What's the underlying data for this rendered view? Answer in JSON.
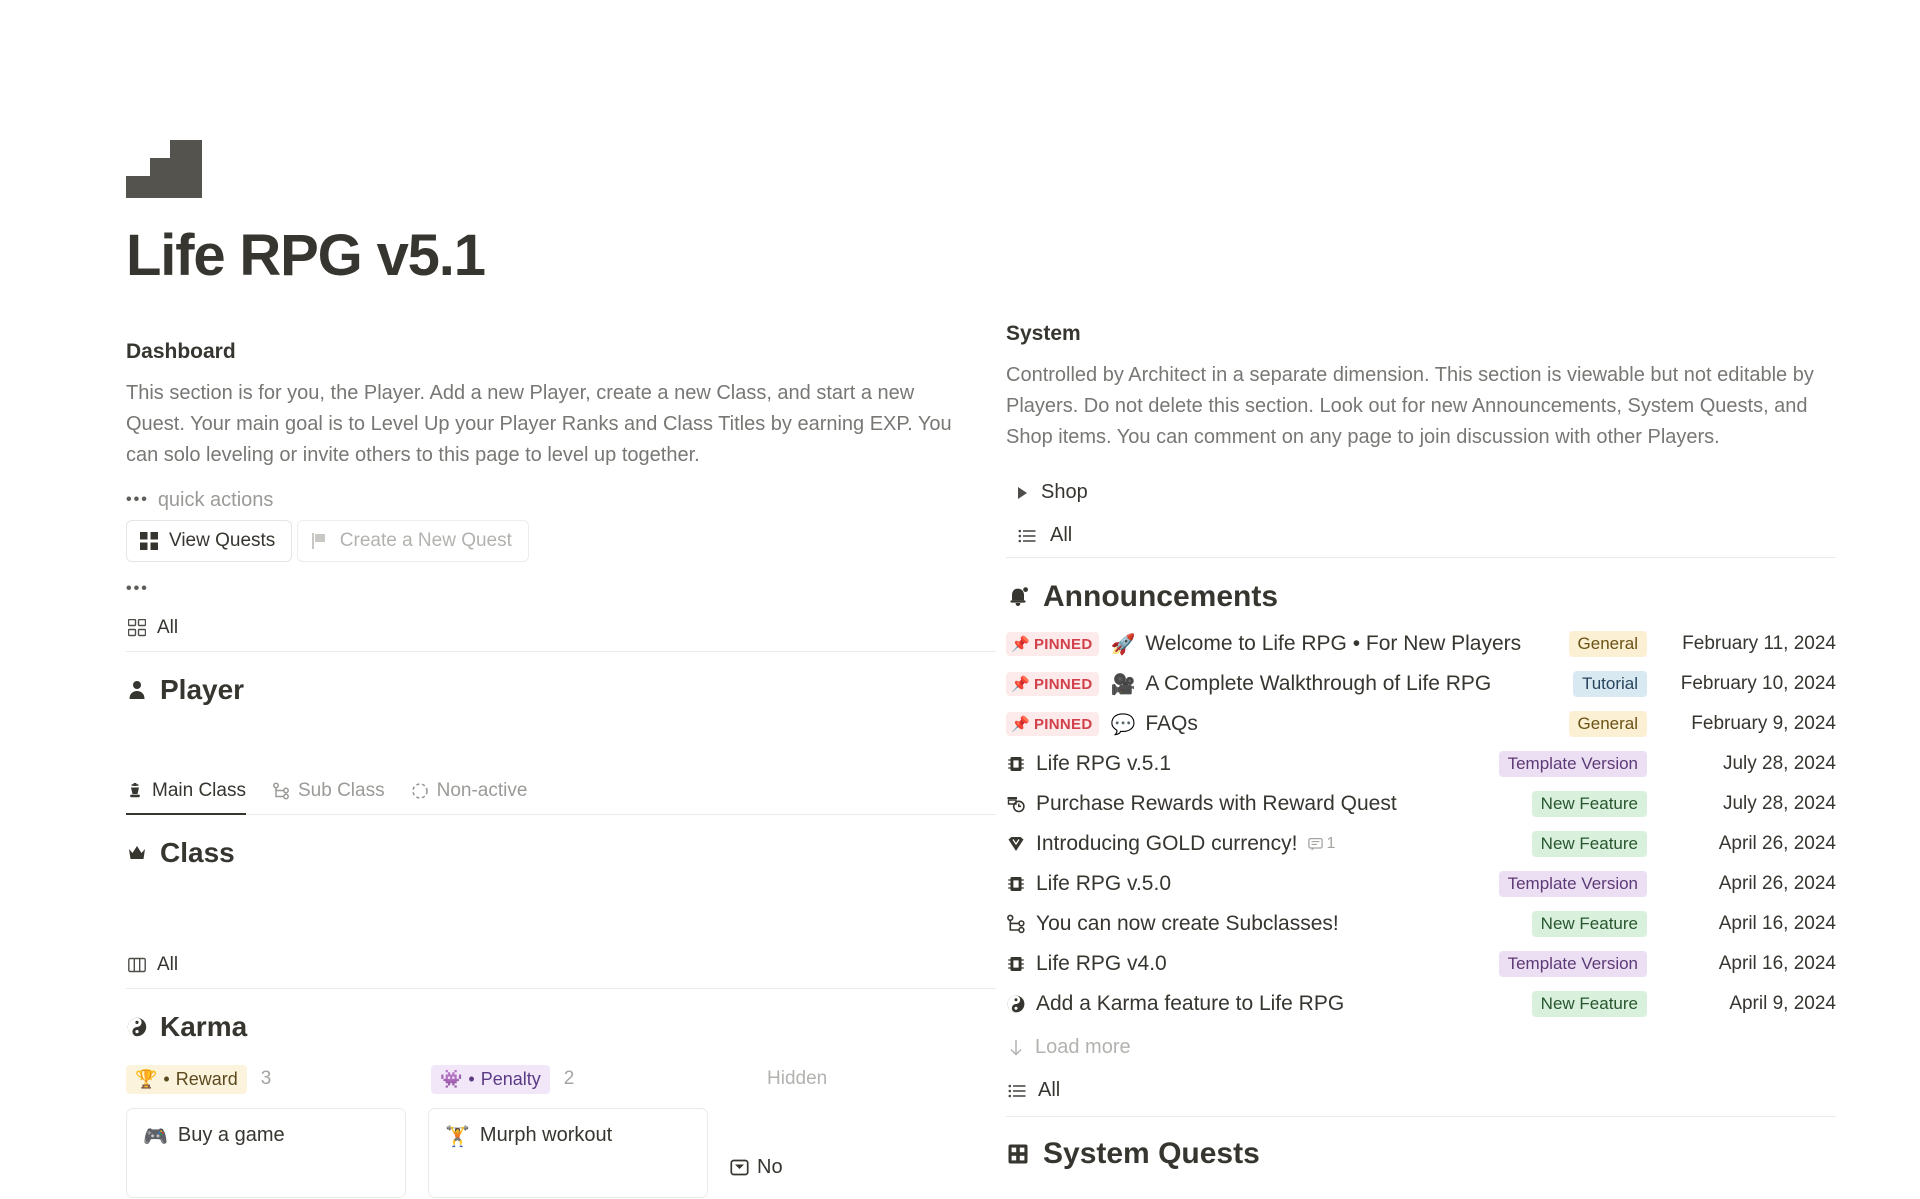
{
  "page": {
    "title": "Life RPG v5.1",
    "icon": "staircase-icon"
  },
  "dashboard": {
    "heading": "Dashboard",
    "description": "This section is for you, the Player. Add a new Player, create a new Class, and start a new Quest. Your main goal is to Level Up your Player Ranks and Class Titles by earning EXP. You can solo leveling or invite others to this page to level up together.",
    "quick_actions_label": "quick actions",
    "dots": "•••",
    "buttons": [
      {
        "label": "View Quests",
        "icon": "grid-icon",
        "style": "solid"
      },
      {
        "label": "Create a New Quest",
        "icon": "flag-icon",
        "style": "ghost"
      }
    ],
    "more_dots": "•••",
    "all_view": {
      "label": "All",
      "icon": "gallery-icon"
    }
  },
  "player": {
    "heading": "Player",
    "icon": "person-icon"
  },
  "class_tabs": [
    {
      "label": "Main Class",
      "icon": "chess-king-icon",
      "active": true
    },
    {
      "label": "Sub Class",
      "icon": "hierarchy-icon",
      "active": false
    },
    {
      "label": "Non-active",
      "icon": "dashed-circle-icon",
      "active": false
    }
  ],
  "class_block": {
    "heading": "Class",
    "icon": "crown-icon",
    "all_view": {
      "label": "All",
      "icon": "board-icon"
    }
  },
  "karma": {
    "heading": "Karma",
    "icon": "yin-yang-icon",
    "groups": [
      {
        "label": "Reward",
        "emoji": "🏆",
        "count": "3",
        "style": "reward"
      },
      {
        "label": "Penalty",
        "emoji": "👾",
        "count": "2",
        "style": "penalty"
      }
    ],
    "hidden_label": "Hidden",
    "no_label": "No",
    "cards": [
      {
        "title": "Buy a game",
        "emoji": "🎮"
      },
      {
        "title": "Murph workout",
        "emoji": "🏋"
      }
    ]
  },
  "system": {
    "heading": "System",
    "description": "Controlled by Architect in a separate dimension. This section is viewable but not editable by Players. Do not delete this section. Look out for new Announcements, System Quests, and Shop items. You can comment on any page to join discussion with other Players.",
    "shop": {
      "label": "Shop",
      "icon": "triangle-right-icon"
    },
    "all_view": {
      "label": "All",
      "icon": "list-icon"
    }
  },
  "announcements": {
    "heading": "Announcements",
    "icon": "megaphone-icon",
    "pinned_label": "PINNED",
    "rows": [
      {
        "pinned": true,
        "emoji": "📌",
        "icon": "rocket-icon",
        "title": "Welcome to Life RPG • For New Players",
        "tag": "General",
        "tag_style": "general",
        "date": "February 11, 2024",
        "comments": ""
      },
      {
        "pinned": true,
        "emoji": "📌",
        "icon": "camera-icon",
        "title": "A Complete Walkthrough of Life RPG",
        "tag": "Tutorial",
        "tag_style": "tutorial",
        "date": "February 10, 2024",
        "comments": ""
      },
      {
        "pinned": true,
        "emoji": "📌",
        "icon": "speech-icon",
        "title": "FAQs",
        "tag": "General",
        "tag_style": "general",
        "date": "February 9, 2024",
        "comments": ""
      },
      {
        "pinned": false,
        "emoji": "",
        "icon": "chip-icon",
        "title": "Life RPG v.5.1",
        "tag": "Template Version",
        "tag_style": "template",
        "date": "July 28, 2024",
        "comments": ""
      },
      {
        "pinned": false,
        "emoji": "",
        "icon": "purchase-icon",
        "title": "Purchase Rewards with Reward Quest",
        "tag": "New Feature",
        "tag_style": "feature",
        "date": "July 28, 2024",
        "comments": ""
      },
      {
        "pinned": false,
        "emoji": "",
        "icon": "gem-icon",
        "title": "Introducing GOLD currency!",
        "tag": "New Feature",
        "tag_style": "feature",
        "date": "April 26, 2024",
        "comments": "1"
      },
      {
        "pinned": false,
        "emoji": "",
        "icon": "chip-icon",
        "title": "Life RPG v.5.0",
        "tag": "Template Version",
        "tag_style": "template",
        "date": "April 26, 2024",
        "comments": ""
      },
      {
        "pinned": false,
        "emoji": "",
        "icon": "hierarchy-icon",
        "title": "You can now create Subclasses!",
        "tag": "New Feature",
        "tag_style": "feature",
        "date": "April 16, 2024",
        "comments": ""
      },
      {
        "pinned": false,
        "emoji": "",
        "icon": "chip-icon",
        "title": "Life RPG v4.0",
        "tag": "Template Version",
        "tag_style": "template",
        "date": "April 16, 2024",
        "comments": ""
      },
      {
        "pinned": false,
        "emoji": "",
        "icon": "yin-yang-icon",
        "title": "Add a Karma feature to Life RPG",
        "tag": "New Feature",
        "tag_style": "feature",
        "date": "April 9, 2024",
        "comments": ""
      }
    ],
    "load_more": "Load more",
    "all_view": {
      "label": "All",
      "icon": "list-icon"
    }
  },
  "system_quests": {
    "heading": "System Quests",
    "icon": "board-grid-icon"
  }
}
